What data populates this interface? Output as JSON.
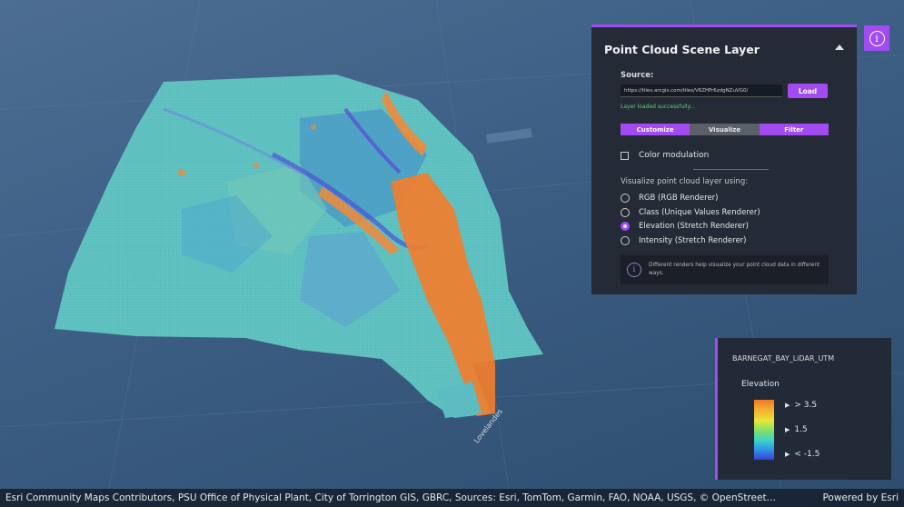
{
  "panel": {
    "title": "Point Cloud Scene Layer",
    "source_label": "Source:",
    "source_url": "https://tiles.arcgis.com/tiles/V6ZHFr6zdgNZuVG0/",
    "load_label": "Load",
    "status": "Layer loaded successfully...",
    "tabs": [
      {
        "label": "Customize",
        "active": true
      },
      {
        "label": "Visualize",
        "active": false
      },
      {
        "label": "Filter",
        "active": true
      }
    ],
    "color_modulation_label": "Color modulation",
    "color_modulation_checked": false,
    "visualize_label": "Visualize point cloud layer using:",
    "renderers": [
      {
        "label": "RGB (RGB Renderer)",
        "selected": false
      },
      {
        "label": "Class (Unique Values Renderer)",
        "selected": false
      },
      {
        "label": "Elevation (Stretch Renderer)",
        "selected": true
      },
      {
        "label": "Intensity (Stretch Renderer)",
        "selected": false
      }
    ],
    "notice": "Different renders help visualize your point cloud data in different ways."
  },
  "info_button": {
    "icon": "info-icon"
  },
  "legend": {
    "layer_name": "BARNEGAT_BAY_LiDAR_UTM",
    "field": "Elevation",
    "labels": [
      "> 3.5",
      "1.5",
      "< -1.5"
    ]
  },
  "map": {
    "street_label": "Lovelandes"
  },
  "attribution": {
    "credits": "Esri Community Maps Contributors, PSU Office of Physical Plant, City of Torrington GIS, GBRC, Sources: Esri, TomTom, Garmin, FAO, NOAA, USGS, © OpenStreet…",
    "powered_by": "Powered by Esri"
  },
  "colors": {
    "accent": "#a14bf0",
    "panel_bg": "#242a36",
    "status_green": "#63d36a",
    "ramp_high": "#f07a24",
    "ramp_mid": "#7ee06a",
    "ramp_low": "#3a3fd9"
  }
}
